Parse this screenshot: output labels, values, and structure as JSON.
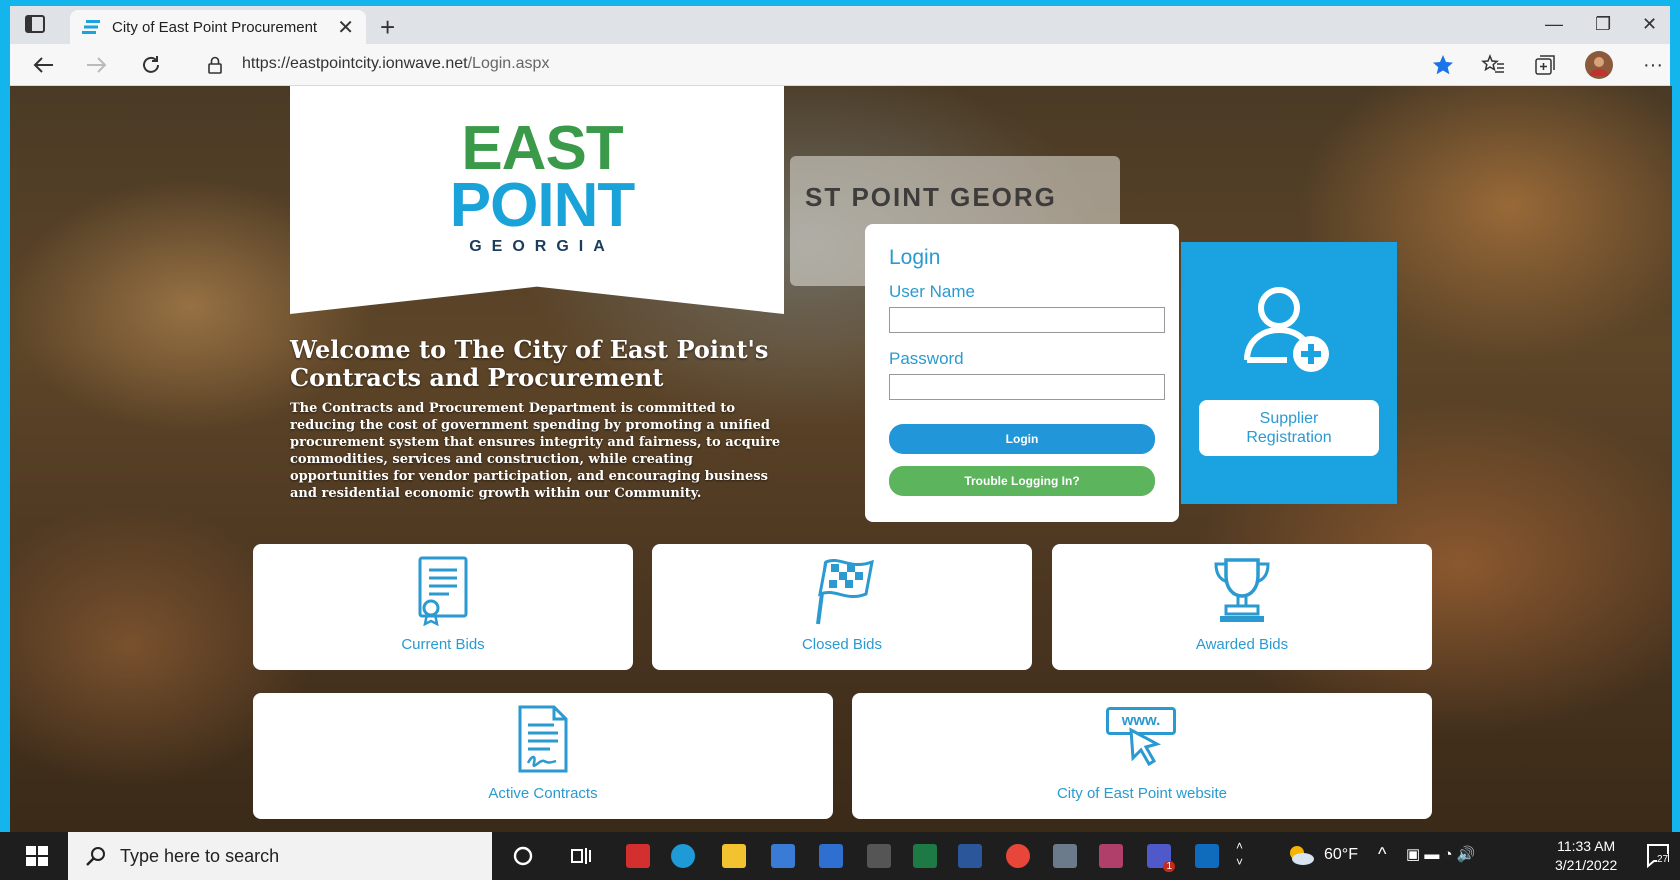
{
  "browser": {
    "tab_title": "City of East Point Procurement",
    "url_host": "https://eastpointcity.ionwave.net",
    "url_path": "/Login.aspx"
  },
  "header": {
    "logo_line1": "EAST",
    "logo_line2": "POINT",
    "logo_line3": "GEORGIA",
    "background_sign": "ST POINT GEORG"
  },
  "welcome": {
    "title": "Welcome to The City of East Point's Contracts and Procurement",
    "body": "The Contracts and Procurement Department is committed to reducing the cost of government spending by promoting a unified procurement system that ensures integrity and fairness, to acquire commodities, services and construction, while creating opportunities for vendor participation, and encouraging business and residential economic growth within our Community."
  },
  "login": {
    "heading": "Login",
    "username_label": "User Name",
    "username_value": "",
    "password_label": "Password",
    "password_value": "",
    "login_button": "Login",
    "trouble_button": "Trouble Logging In?"
  },
  "supplier": {
    "label_line1": "Supplier",
    "label_line2": "Registration"
  },
  "tiles": {
    "current_bids": "Current Bids",
    "closed_bids": "Closed Bids",
    "awarded_bids": "Awarded Bids",
    "active_contracts": "Active Contracts",
    "city_website": "City of East Point website",
    "website_icon_text": "www."
  },
  "taskbar": {
    "search_placeholder": "Type here to search",
    "weather": "60°F",
    "time": "11:33 AM",
    "date": "3/21/2022",
    "notification_count": "27",
    "teams_badge": "1"
  },
  "colors": {
    "accent_blue": "#1aa3e0",
    "logo_green": "#3a9a4a",
    "login_green": "#5cb45c"
  }
}
